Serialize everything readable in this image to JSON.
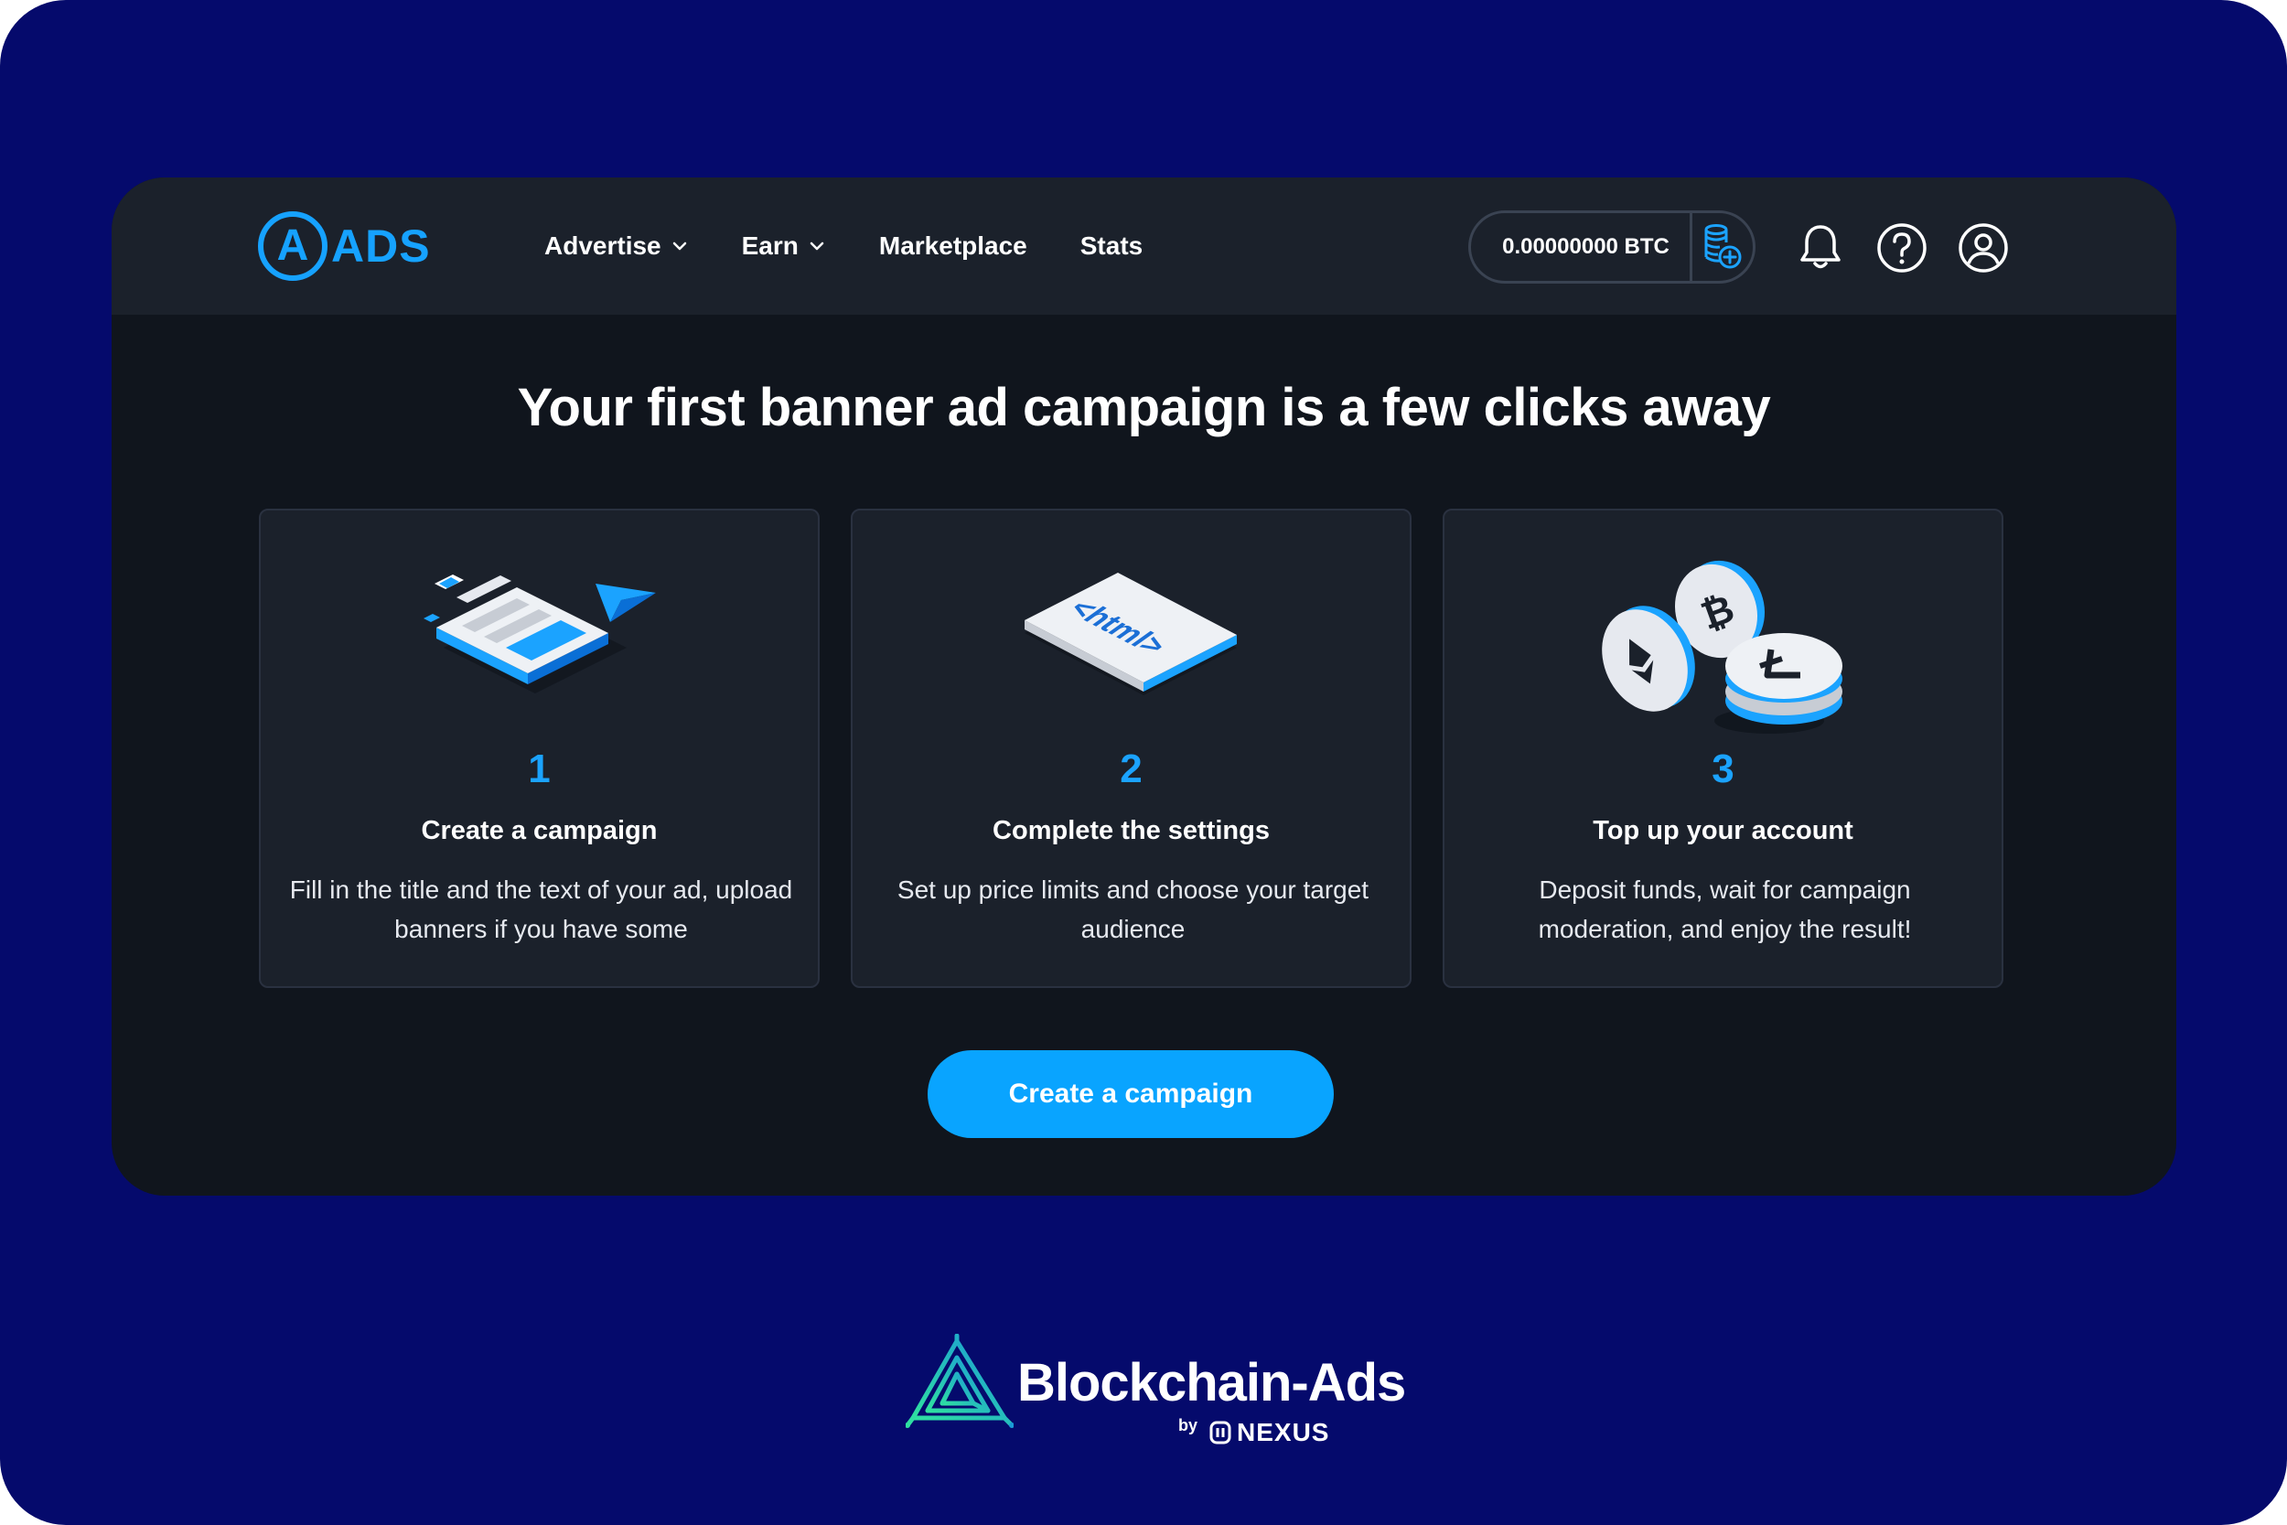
{
  "app": {
    "logo_letter": "A",
    "logo_text": "ADS"
  },
  "nav": {
    "items": [
      {
        "label": "Advertise",
        "has_dropdown": true
      },
      {
        "label": "Earn",
        "has_dropdown": true
      },
      {
        "label": "Marketplace",
        "has_dropdown": false
      },
      {
        "label": "Stats",
        "has_dropdown": false
      }
    ]
  },
  "header": {
    "balance": "0.00000000  BTC",
    "icons": [
      "coins-add-icon",
      "bell-icon",
      "help-icon",
      "user-icon"
    ]
  },
  "main": {
    "headline": "Your first banner ad campaign is a few clicks away",
    "steps": [
      {
        "number": "1",
        "title": "Create a campaign",
        "description": "Fill in the title and the text of your ad, upload banners if you have some",
        "illustration": "banner-editor-illustration"
      },
      {
        "number": "2",
        "title": "Complete the settings",
        "description": "Set up price limits and choose your target audience",
        "illustration": "html-card-illustration"
      },
      {
        "number": "3",
        "title": "Top up your account",
        "description": "Deposit funds, wait for campaign moderation, and enjoy the result!",
        "illustration": "crypto-coins-illustration"
      }
    ],
    "cta_label": "Create a campaign"
  },
  "footer": {
    "brand_name": "Blockchain-Ads",
    "by": "by",
    "partner": "NEXUS"
  },
  "colors": {
    "background": "#050a6c",
    "window": "#10151d",
    "topbar": "#1b212b",
    "card": "#1b212b",
    "accent": "#09a4ff",
    "brand_teal": "#2fd3a6"
  }
}
